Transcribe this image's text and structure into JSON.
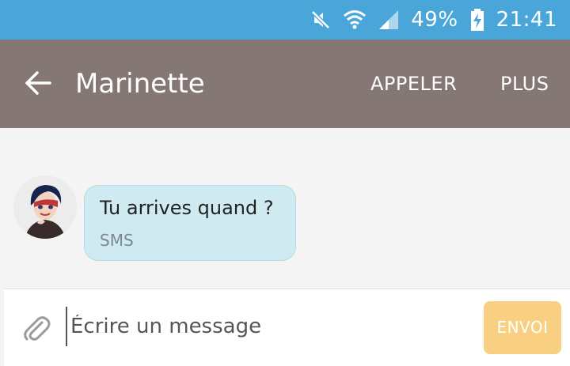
{
  "status_bar": {
    "battery_percent": "49%",
    "time": "21:41",
    "icons": [
      "mute-icon",
      "wifi-icon",
      "signal-icon",
      "battery-charging-icon"
    ]
  },
  "app_bar": {
    "contact_name": "Marinette",
    "call_label": "APPELER",
    "more_label": "PLUS",
    "color": "#857773"
  },
  "conversation": {
    "messages": [
      {
        "text": "Tu arrives quand ?",
        "type": "SMS",
        "direction": "incoming"
      }
    ]
  },
  "composer": {
    "placeholder": "Écrire un message",
    "value": "",
    "send_label": "ENVOI"
  },
  "colors": {
    "status_bar": "#4aa6d8",
    "app_bar": "#857773",
    "bubble": "#cfeaf0",
    "send_button": "#f9cf81"
  }
}
